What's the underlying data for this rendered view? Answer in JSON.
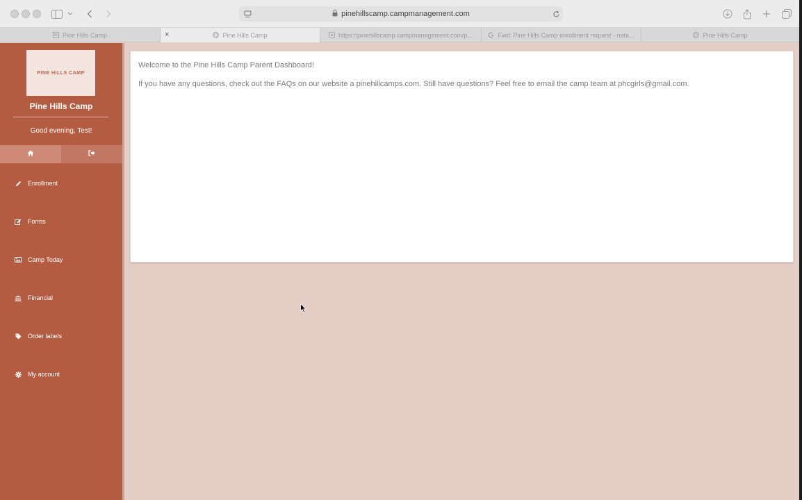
{
  "browser": {
    "url": "pinehillscamp.campmanagement.com",
    "tabs": [
      {
        "label": "Pine Hills Camp",
        "favicon": "doc-icon",
        "active": false
      },
      {
        "label": "Pine Hills Camp",
        "favicon": "globe-icon",
        "active": true
      },
      {
        "label": "https://pinehillscamp.campmanagement.com/p...",
        "favicon": "page-icon",
        "active": false
      },
      {
        "label": "Fwd: Pine Hills Camp enrollment request - nata...",
        "favicon": "google-icon",
        "active": false
      },
      {
        "label": "Pine Hills Camp",
        "favicon": "globe-icon",
        "active": false
      }
    ],
    "close_glyph": "×"
  },
  "sidebar": {
    "logo_text": "PINE HILLS CAMP",
    "camp_name": "Pine Hills Camp",
    "greeting": "Good evening, Test!",
    "icon_bar": [
      {
        "name": "home-icon"
      },
      {
        "name": "logout-icon"
      }
    ],
    "items": [
      {
        "label": "Enrollment",
        "icon": "pencil-icon"
      },
      {
        "label": "Forms",
        "icon": "edit-form-icon"
      },
      {
        "label": "Camp Today",
        "icon": "image-icon"
      },
      {
        "label": "Financial",
        "icon": "bank-icon"
      },
      {
        "label": "Order labels",
        "icon": "tag-icon"
      },
      {
        "label": "My account",
        "icon": "gear-icon"
      }
    ]
  },
  "main": {
    "welcome": "Welcome to the Pine Hills Camp Parent Dashboard!",
    "faq": "If you have any questions, check out the FAQs on our website a pinehillcamps.com.  Still have questions?  Feel free to email the camp team at phcgirls@gmail.com."
  },
  "colors": {
    "sidebar": "#b35c41",
    "background": "#e3cdc5",
    "card": "#ffffff"
  }
}
